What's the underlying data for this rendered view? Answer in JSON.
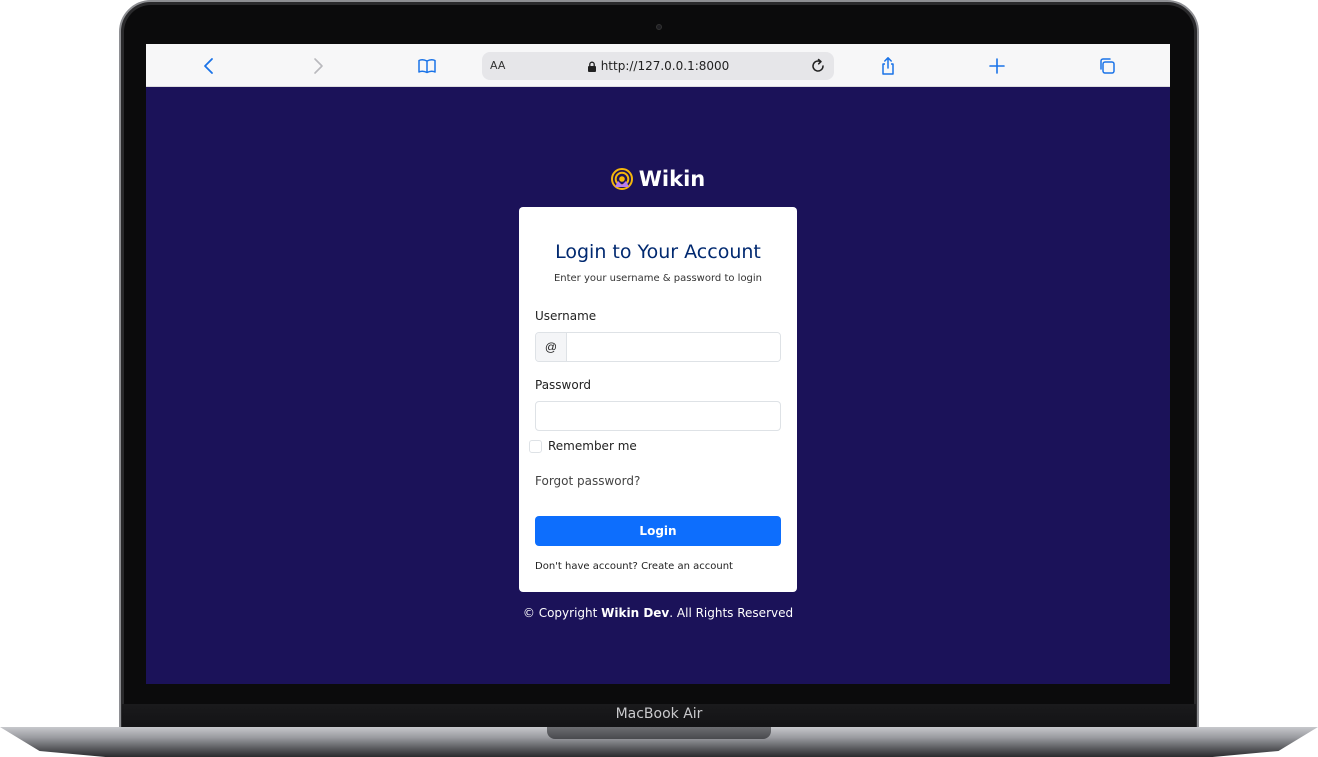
{
  "browser": {
    "reader_label": "AA",
    "url": "http://127.0.0.1:8000",
    "icons": [
      "back-icon",
      "forward-icon",
      "bookmarks-icon",
      "lock-icon",
      "reload-icon",
      "share-icon",
      "new-tab-icon",
      "tabs-icon"
    ]
  },
  "brand": {
    "name": "Wikin",
    "logo_colors": [
      "#f5b60b",
      "#b77df0"
    ]
  },
  "login_card": {
    "title": "Login to Your Account",
    "subtitle": "Enter your username & password to login",
    "username_label": "Username",
    "username_prefix": "@",
    "username_value": "",
    "password_label": "Password",
    "password_value": "",
    "remember_label": "Remember me",
    "remember_checked": false,
    "forgot_link": "Forgot password?",
    "login_button": "Login",
    "signup_prompt": "Don't have account?",
    "signup_link": "Create an account"
  },
  "footer": {
    "prefix": "© Copyright",
    "company": "Wikin Dev",
    "suffix": ". All Rights Reserved"
  },
  "device": {
    "model_label": "MacBook Air"
  },
  "colors": {
    "page_background": "#1b1259",
    "primary_button": "#0d6efd",
    "title": "#012970",
    "browser_accent": "#1a73e8"
  }
}
